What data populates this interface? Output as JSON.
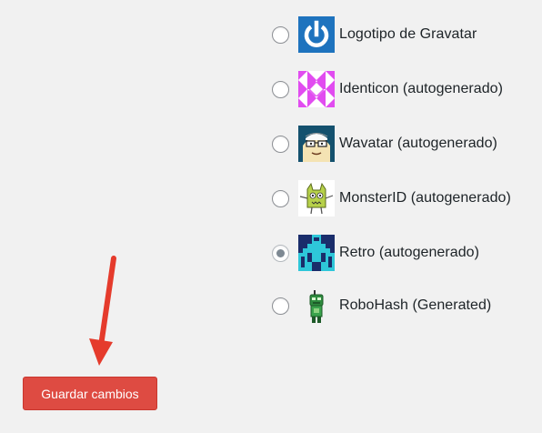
{
  "avatars": [
    {
      "label": "Logotipo de Gravatar",
      "icon": "gravatar-logo-icon",
      "selected": false
    },
    {
      "label": "Identicon (autogenerado)",
      "icon": "identicon-icon",
      "selected": false
    },
    {
      "label": "Wavatar (autogenerado)",
      "icon": "wavatar-icon",
      "selected": false
    },
    {
      "label": "MonsterID (autogenerado)",
      "icon": "monsterid-icon",
      "selected": false
    },
    {
      "label": "Retro (autogenerado)",
      "icon": "retro-icon",
      "selected": true
    },
    {
      "label": "RoboHash (Generated)",
      "icon": "robohash-icon",
      "selected": false
    }
  ],
  "save_button": {
    "label": "Guardar cambios"
  },
  "colors": {
    "save_button_bg": "#de4b42",
    "annotation_arrow": "#e53b2c",
    "gravatar_blue": "#1e73be",
    "identicon_magenta": "#e14cf0"
  }
}
